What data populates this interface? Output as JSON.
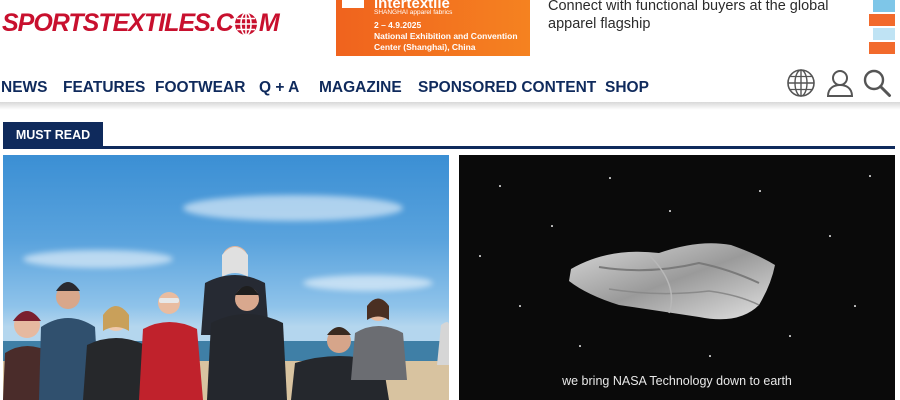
{
  "site": {
    "logo_text_main": "SPORTSTEXTILES.C",
    "logo_text_end": "M",
    "logo_icon": "globe-icon"
  },
  "ad": {
    "brand": "intertextile",
    "sub": "SHANGHAI apparel fabrics",
    "date": "2 – 4.9.2025",
    "venue": "National Exhibition and Convention Center (Shanghai), China",
    "copy": "Connect with functional buyers at the global apparel flagship",
    "colors": {
      "orange": "#f58220",
      "blue": "#7ec6e8"
    }
  },
  "nav": {
    "items": [
      "NEWS",
      "FEATURES",
      "FOOTWEAR",
      "Q + A",
      "MAGAZINE",
      "SPONSORED CONTENT",
      "SHOP"
    ],
    "icons": [
      "globe-icon",
      "user-icon",
      "search-icon"
    ]
  },
  "section": {
    "title": "MUST READ"
  },
  "cards": {
    "right_subtitle": "we bring NASA Technology down to earth"
  },
  "colors": {
    "brand_red": "#c8102e",
    "navy": "#0f2a5c"
  }
}
